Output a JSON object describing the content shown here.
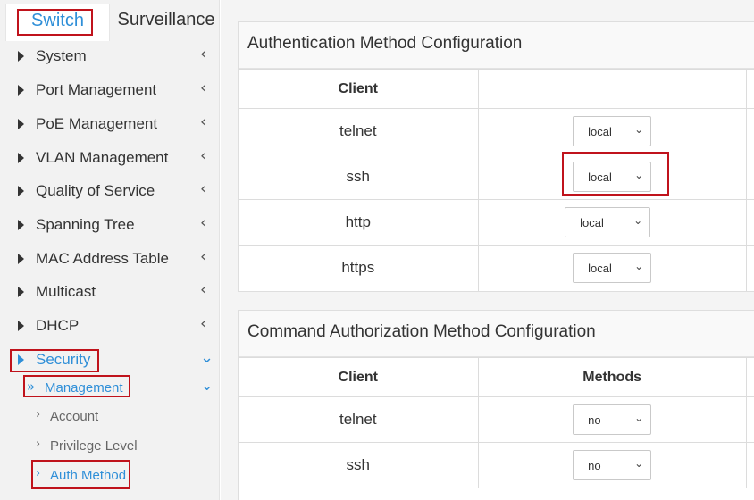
{
  "tabs": {
    "switch": "Switch",
    "surveillance": "Surveillance"
  },
  "sidebar": {
    "items": [
      {
        "label": "System",
        "chevron": "‹"
      },
      {
        "label": "Port Management",
        "chevron": "‹"
      },
      {
        "label": "PoE Management",
        "chevron": "‹"
      },
      {
        "label": "VLAN Management",
        "chevron": "‹"
      },
      {
        "label": "Quality of Service",
        "chevron": "‹"
      },
      {
        "label": "Spanning Tree",
        "chevron": "‹"
      },
      {
        "label": "MAC Address Table",
        "chevron": "‹"
      },
      {
        "label": "Multicast",
        "chevron": "‹"
      },
      {
        "label": "DHCP",
        "chevron": "‹"
      },
      {
        "label": "Security",
        "chevron": "⌄"
      }
    ],
    "submenu": {
      "label": "Management",
      "prefix": "»",
      "chevron": "⌄"
    },
    "leaves": [
      {
        "label": "Account",
        "prefix": "›"
      },
      {
        "label": "Privilege Level",
        "prefix": "›"
      },
      {
        "label": "Auth Method",
        "prefix": "›"
      }
    ]
  },
  "auth_panel": {
    "title": "Authentication Method Configuration",
    "header": {
      "client": "Client",
      "methods": ""
    },
    "rows": [
      {
        "client": "telnet",
        "method": "local"
      },
      {
        "client": "ssh",
        "method": "local"
      },
      {
        "client": "http",
        "method": "local"
      },
      {
        "client": "https",
        "method": "local"
      }
    ]
  },
  "cmd_panel": {
    "title": "Command Authorization Method Configuration",
    "header": {
      "client": "Client",
      "methods": "Methods"
    },
    "rows": [
      {
        "client": "telnet",
        "method": "no"
      },
      {
        "client": "ssh",
        "method": "no"
      }
    ]
  },
  "icons": {
    "select_caret": "⌄",
    "menu_triangle": "triangle-right-icon"
  },
  "colors": {
    "accent": "#2f8fd8",
    "highlight_box": "#c0131c"
  }
}
